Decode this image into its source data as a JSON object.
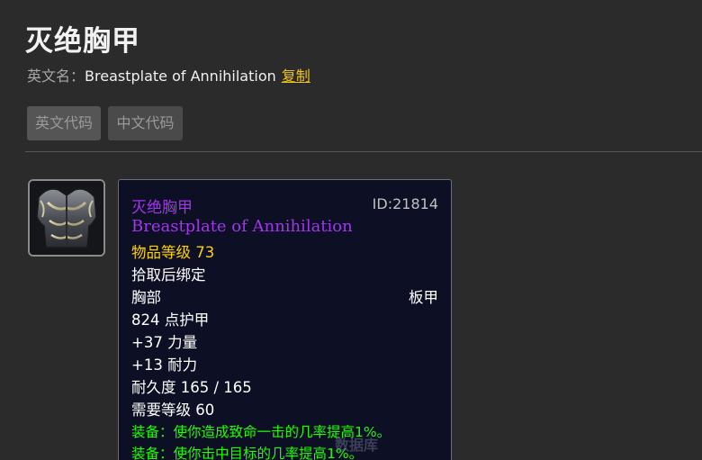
{
  "page": {
    "title": "灭绝胸甲",
    "en_label": "英文名：",
    "en_value": "Breastplate of Annihilation",
    "copy_label": "复制"
  },
  "buttons": {
    "en_code": "英文代码",
    "cn_code": "中文代码"
  },
  "tooltip": {
    "name": "灭绝胸甲",
    "id": "ID:21814",
    "en_name": "Breastplate of Annihilation",
    "item_level": "物品等级 73",
    "bind": "拾取后绑定",
    "slot": "胸部",
    "armor_type": "板甲",
    "armor": "824 点护甲",
    "strength": "+37 力量",
    "stamina": "+13 耐力",
    "durability": "耐久度 165 / 165",
    "requires_level": "需要等级 60",
    "equip_1": "装备：使你造成致命一击的几率提高1%。",
    "equip_2": "装备：使你击中目标的几率提高1%。"
  },
  "watermark": "数据库",
  "colors": {
    "background": "#2b2b2b",
    "epic_purple": "#a335ee",
    "item_level_yellow": "#ffd100",
    "equip_green": "#1eff00",
    "link_yellow": "#f0c419",
    "tooltip_bg": "#0d0f24"
  },
  "icons": {
    "item_icon": "breastplate-icon"
  }
}
